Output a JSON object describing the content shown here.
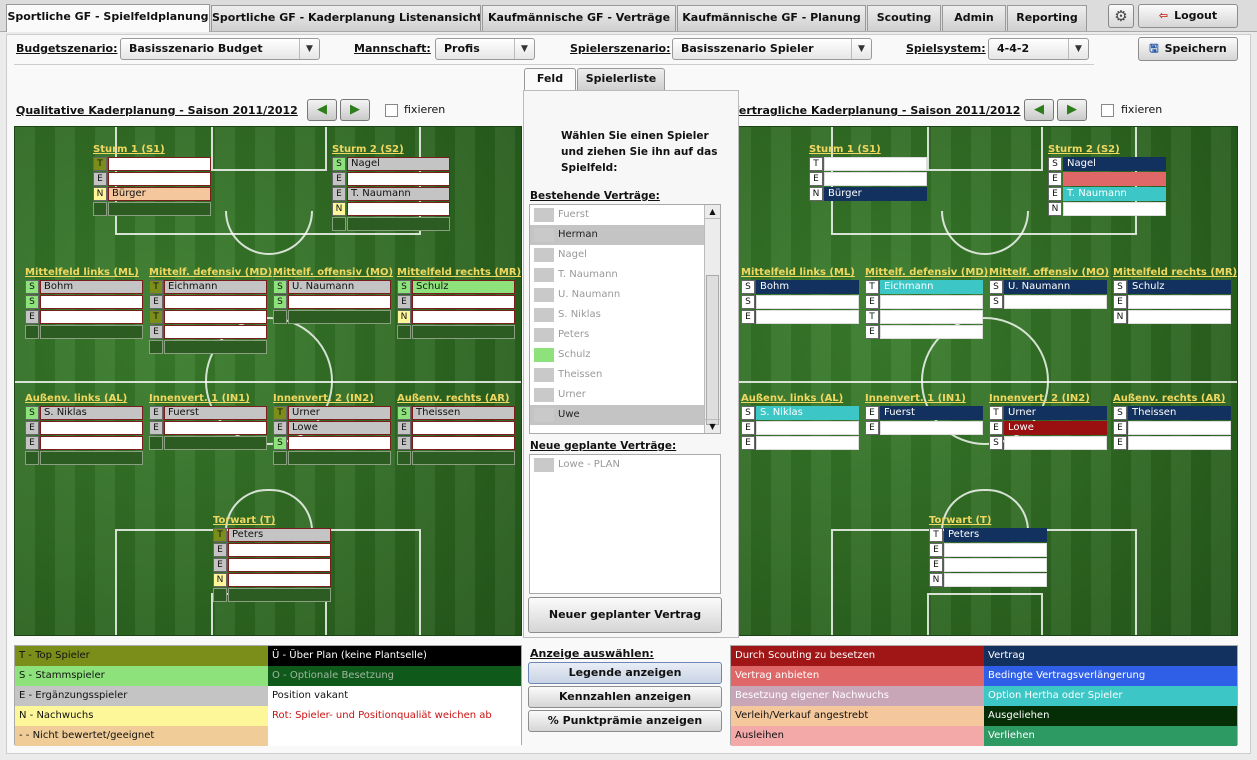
{
  "tabs": [
    "Sportliche GF - Spielfeldplanung",
    "Sportliche GF - Kaderplanung Listenansicht",
    "Kaufmännische GF - Verträge",
    "Kaufmännische GF - Planung",
    "Scouting",
    "Admin",
    "Reporting"
  ],
  "logout_label": "Logout",
  "settings_icon": "gear-icon",
  "filters": {
    "budget_label": "Budgetszenario:",
    "budget_value": "Basisszenario Budget",
    "team_label": "Mannschaft:",
    "team_value": "Profis",
    "player_label": "Spielerszenario:",
    "player_value": "Basisszenario Spieler",
    "system_label": "Spielsystem:",
    "system_value": "4-4-2"
  },
  "save_label": "Speichern",
  "left_title": "Qualitative Kaderplanung - Saison 2011/2012",
  "right_title": "Vertragliche Kaderplanung - Saison 2011/2012",
  "fix_label": "fixieren",
  "center": {
    "tab_field": "Feld",
    "tab_list": "Spielerliste",
    "instruction": "Wählen Sie einen Spieler und ziehen Sie ihn auf das Spielfeld:",
    "existing_label": "Bestehende Verträge:",
    "existing": [
      {
        "name": "Fuerst",
        "hl": false,
        "color": "#c9c9c9"
      },
      {
        "name": "Herman",
        "hl": true,
        "color": "#c9c9c9"
      },
      {
        "name": "Nagel",
        "hl": false,
        "color": "#c9c9c9"
      },
      {
        "name": "T. Naumann",
        "hl": false,
        "color": "#c9c9c9"
      },
      {
        "name": "U. Naumann",
        "hl": false,
        "color": "#c9c9c9"
      },
      {
        "name": "S. Niklas",
        "hl": false,
        "color": "#c9c9c9"
      },
      {
        "name": "Peters",
        "hl": false,
        "color": "#c9c9c9"
      },
      {
        "name": "Schulz",
        "hl": false,
        "color": "#8ee27c"
      },
      {
        "name": "Theissen",
        "hl": false,
        "color": "#c9c9c9"
      },
      {
        "name": "Urner",
        "hl": false,
        "color": "#c9c9c9"
      },
      {
        "name": "Uwe",
        "hl": true,
        "color": "#c9c9c9"
      }
    ],
    "planned_label": "Neue geplante Verträge:",
    "planned": [
      {
        "name": "Lowe  - PLAN"
      }
    ],
    "new_contract_btn": "Neuer geplanter Vertrag"
  },
  "left_positions": [
    {
      "title": "Sturm 1 (S1)",
      "rows": [
        [
          "T",
          "",
          "nm-white"
        ],
        [
          "E",
          "",
          "nm-white"
        ],
        [
          "N",
          "Bürger",
          "nm-orange"
        ],
        [
          "X",
          "",
          "nm-empty"
        ]
      ]
    },
    {
      "title": "Sturm 2 (S2)",
      "rows": [
        [
          "S",
          "Nagel",
          "nm-grey"
        ],
        [
          "E",
          "",
          "nm-white"
        ],
        [
          "E",
          "T. Naumann",
          "nm-grey"
        ],
        [
          "N",
          "",
          "nm-white"
        ],
        [
          "X",
          "",
          "nm-empty"
        ]
      ]
    },
    {
      "title": "Mittelfeld links (ML)",
      "rows": [
        [
          "S",
          "Bohm",
          "nm-grey"
        ],
        [
          "S",
          "",
          "nm-white"
        ],
        [
          "E",
          "",
          "nm-white"
        ],
        [
          "X",
          "",
          "nm-empty"
        ]
      ]
    },
    {
      "title": "Mittelf. defensiv (MD)",
      "rows": [
        [
          "T",
          "Eichmann",
          "nm-grey"
        ],
        [
          "E",
          "",
          "nm-white"
        ],
        [
          "T",
          "",
          "nm-white"
        ],
        [
          "E",
          "",
          "nm-white"
        ],
        [
          "X",
          "",
          "nm-empty"
        ]
      ]
    },
    {
      "title": "Mittelf. offensiv (MO)",
      "rows": [
        [
          "S",
          "U. Naumann",
          "nm-grey"
        ],
        [
          "S",
          "",
          "nm-white"
        ],
        [
          "X",
          "",
          "nm-empty"
        ]
      ]
    },
    {
      "title": "Mittelfeld rechts (MR)",
      "rows": [
        [
          "S",
          "Schulz",
          "nm-green"
        ],
        [
          "E",
          "",
          "nm-white"
        ],
        [
          "N",
          "",
          "nm-white"
        ],
        [
          "X",
          "",
          "nm-empty"
        ]
      ]
    },
    {
      "title": "Außenv. links (AL)",
      "rows": [
        [
          "S",
          "S. Niklas",
          "nm-grey"
        ],
        [
          "E",
          "",
          "nm-white"
        ],
        [
          "E",
          "",
          "nm-white"
        ],
        [
          "X",
          "",
          "nm-empty"
        ]
      ]
    },
    {
      "title": "Innenvert. 1 (IN1)",
      "rows": [
        [
          "E",
          "Fuerst",
          "nm-grey"
        ],
        [
          "E",
          "",
          "nm-white"
        ],
        [
          "X",
          "",
          "nm-empty"
        ]
      ]
    },
    {
      "title": "Innenvert. 2 (IN2)",
      "rows": [
        [
          "T",
          "Urner",
          "nm-grey"
        ],
        [
          "E",
          "Lowe",
          "nm-grey"
        ],
        [
          "S",
          "",
          "nm-white"
        ],
        [
          "X",
          "",
          "nm-empty"
        ]
      ]
    },
    {
      "title": "Außenv. rechts (AR)",
      "rows": [
        [
          "S",
          "Theissen",
          "nm-grey"
        ],
        [
          "E",
          "",
          "nm-white"
        ],
        [
          "E",
          "",
          "nm-white"
        ],
        [
          "X",
          "",
          "nm-empty"
        ]
      ]
    },
    {
      "title": "Torwart (T)",
      "rows": [
        [
          "T",
          "Peters",
          "nm-grey"
        ],
        [
          "E",
          "",
          "nm-white"
        ],
        [
          "E",
          "",
          "nm-white"
        ],
        [
          "N",
          "",
          "nm-white"
        ],
        [
          "X",
          "",
          "nm-empty"
        ]
      ]
    }
  ],
  "right_positions": [
    {
      "title": "Sturm 1 (S1)",
      "rows": [
        [
          "T",
          "",
          "nm-white"
        ],
        [
          "E",
          "",
          "nm-white"
        ],
        [
          "N",
          "Bürger",
          "nm-navy"
        ]
      ]
    },
    {
      "title": "Sturm 2 (S2)",
      "rows": [
        [
          "S",
          "Nagel",
          "nm-navy"
        ],
        [
          "E",
          "",
          "nm-red"
        ],
        [
          "E",
          "T. Naumann",
          "nm-teal"
        ],
        [
          "N",
          "",
          "nm-white"
        ]
      ]
    },
    {
      "title": "Mittelfeld links (ML)",
      "rows": [
        [
          "S",
          "Bohm",
          "nm-navy"
        ],
        [
          "S",
          "",
          "nm-white"
        ],
        [
          "E",
          "",
          "nm-white"
        ]
      ]
    },
    {
      "title": "Mittelf. defensiv (MD)",
      "rows": [
        [
          "T",
          "Eichmann",
          "nm-teal"
        ],
        [
          "E",
          "",
          "nm-white"
        ],
        [
          "T",
          "",
          "nm-white"
        ],
        [
          "E",
          "",
          "nm-white"
        ]
      ]
    },
    {
      "title": "Mittelf. offensiv (MO)",
      "rows": [
        [
          "S",
          "U. Naumann",
          "nm-navy"
        ],
        [
          "S",
          "",
          "nm-white"
        ]
      ]
    },
    {
      "title": "Mittelfeld rechts (MR)",
      "rows": [
        [
          "S",
          "Schulz",
          "nm-navy"
        ],
        [
          "E",
          "",
          "nm-white"
        ],
        [
          "N",
          "",
          "nm-white"
        ]
      ]
    },
    {
      "title": "Außenv. links (AL)",
      "rows": [
        [
          "S",
          "S. Niklas",
          "nm-teal"
        ],
        [
          "E",
          "",
          "nm-white"
        ],
        [
          "E",
          "",
          "nm-white"
        ]
      ]
    },
    {
      "title": "Innenvert. 1 (IN1)",
      "rows": [
        [
          "E",
          "Fuerst",
          "nm-navy"
        ],
        [
          "E",
          "",
          "nm-white"
        ]
      ]
    },
    {
      "title": "Innenvert. 2 (IN2)",
      "rows": [
        [
          "T",
          "Urner",
          "nm-navy"
        ],
        [
          "E",
          "Lowe",
          "nm-darkred"
        ],
        [
          "S",
          "",
          "nm-white"
        ]
      ]
    },
    {
      "title": "Außenv. rechts (AR)",
      "rows": [
        [
          "S",
          "Theissen",
          "nm-navy"
        ],
        [
          "E",
          "",
          "nm-white"
        ],
        [
          "E",
          "",
          "nm-white"
        ]
      ]
    },
    {
      "title": "Torwart (T)",
      "rows": [
        [
          "T",
          "Peters",
          "nm-navy"
        ],
        [
          "E",
          "",
          "nm-white"
        ],
        [
          "E",
          "",
          "nm-white"
        ],
        [
          "N",
          "",
          "nm-white"
        ]
      ]
    }
  ],
  "legend_left": [
    {
      "text": "T - Top Spieler",
      "bg": "#7b8e1a",
      "fg": "#111"
    },
    {
      "text": "Ü - Über Plan (keine Plantselle)",
      "bg": "#000000",
      "fg": "#ffffff"
    },
    {
      "text": "S - Stammspieler",
      "bg": "#8ee27c",
      "fg": "#111"
    },
    {
      "text": "O - Optionale Besetzung",
      "bg": "#0f5a1b",
      "fg": "#9fb79f"
    },
    {
      "text": "E - Ergänzungsspieler",
      "bg": "#c4c4c4",
      "fg": "#111"
    },
    {
      "text": "Position vakant",
      "bg": "#ffffff",
      "fg": "#111"
    },
    {
      "text": "N - Nachwuchs",
      "bg": "#fef79a",
      "fg": "#111"
    },
    {
      "text": "Rot: Spieler- und Positionqualiät weichen ab",
      "bg": "#ffffff",
      "fg": "#cc1111"
    },
    {
      "text": "- - Nicht bewertet/geeignet",
      "bg": "#f0cd98",
      "fg": "#111"
    },
    {
      "text": "",
      "bg": "#ffffff",
      "fg": "#111"
    }
  ],
  "display_label": "Anzeige auswählen:",
  "display_buttons": [
    "Legende anzeigen",
    "Kennzahlen anzeigen",
    "% Punktprämie anzeigen"
  ],
  "legend_right": [
    {
      "text": "Durch Scouting zu besetzen",
      "bg": "#a01616",
      "fg": "#ffffff"
    },
    {
      "text": "Vertrag",
      "bg": "#13315f",
      "fg": "#ffffff"
    },
    {
      "text": "Vertrag anbieten",
      "bg": "#e06767",
      "fg": "#ffffff"
    },
    {
      "text": "Bedingte Vertragsverlängerung",
      "bg": "#2f5fe6",
      "fg": "#ffffff"
    },
    {
      "text": "Besetzung eigener Nachwuchs",
      "bg": "#c9a5b8",
      "fg": "#ffffff"
    },
    {
      "text": "Option Hertha oder Spieler",
      "bg": "#3cc6c6",
      "fg": "#ffffff"
    },
    {
      "text": "Verleih/Verkauf angestrebt",
      "bg": "#f5c79c",
      "fg": "#111"
    },
    {
      "text": "Ausgeliehen",
      "bg": "#062e06",
      "fg": "#ffffff"
    },
    {
      "text": "Ausleihen",
      "bg": "#f4a9a9",
      "fg": "#111"
    },
    {
      "text": "Verliehen",
      "bg": "#2e9a63",
      "fg": "#ffffff"
    }
  ]
}
